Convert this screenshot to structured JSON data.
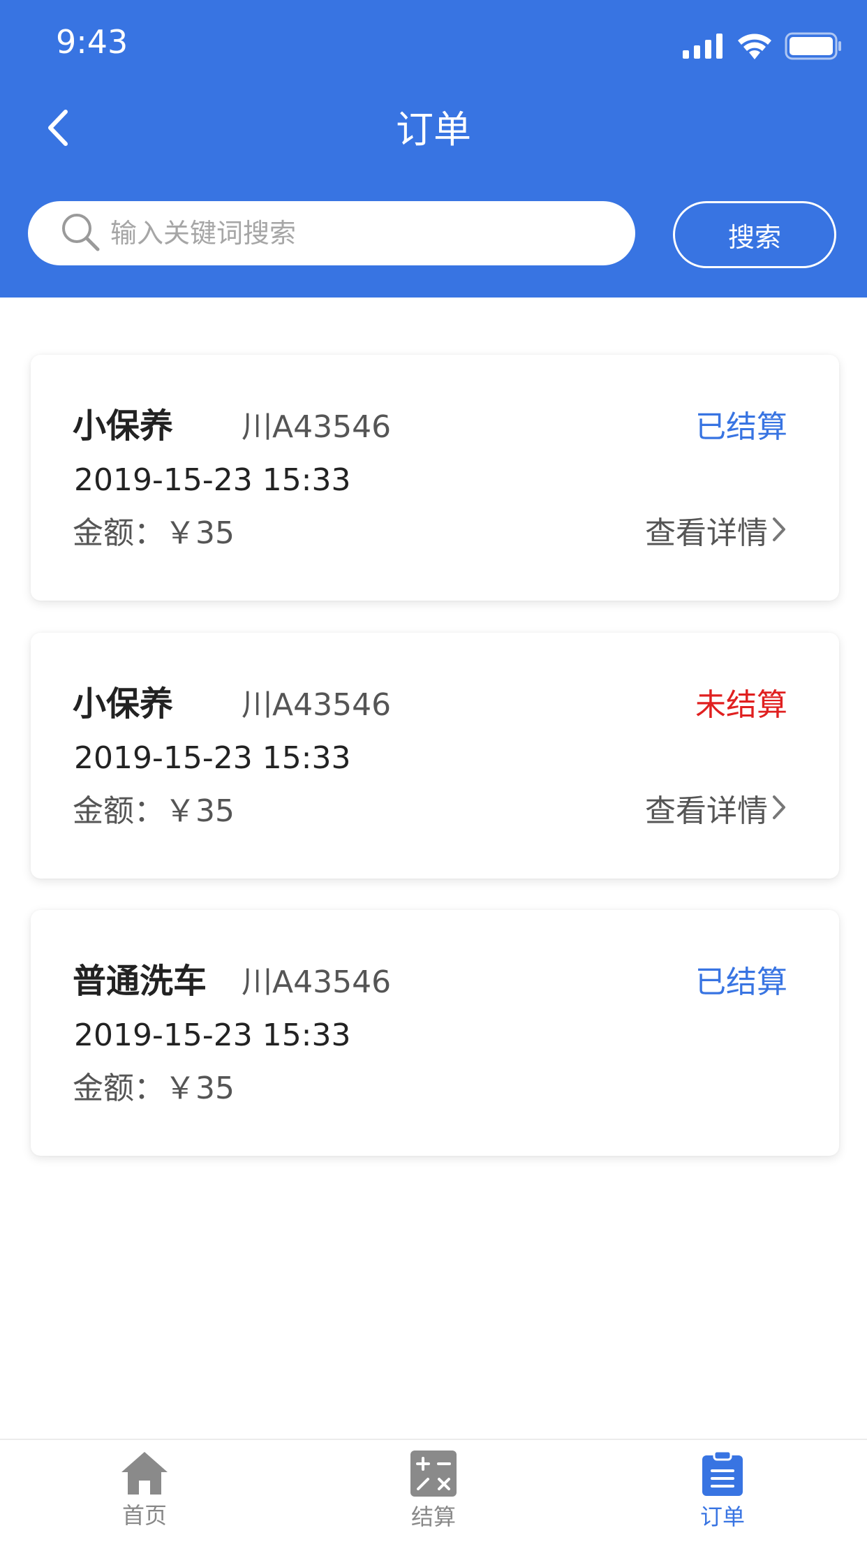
{
  "status_bar": {
    "time": "9:43",
    "icons": [
      "signal-icon",
      "wifi-icon",
      "battery-icon"
    ]
  },
  "nav": {
    "title": "订单",
    "back_icon": "chevron-left-icon"
  },
  "search": {
    "placeholder": "输入关键词搜索",
    "value": "",
    "button_label": "搜索"
  },
  "orders": [
    {
      "service": "小保养",
      "plate": "川A43546",
      "status": "已结算",
      "datetime": "2019-15-23 15:33",
      "amount_label": "金额：",
      "amount": "￥35",
      "detail_label": "查看详情"
    },
    {
      "service": "小保养",
      "plate": "川A43546",
      "status": "未结算",
      "datetime": "2019-15-23 15:33",
      "amount_label": "金额：",
      "amount": "￥35",
      "detail_label": "查看详情"
    },
    {
      "service": "普通洗车",
      "plate": "川A43546",
      "status": "已结算",
      "datetime": "2019-15-23 15:33",
      "amount_label": "金额：",
      "amount": "￥35"
    }
  ],
  "tabs": [
    {
      "label": "首页",
      "icon": "home-icon",
      "active": false
    },
    {
      "label": "结算",
      "icon": "calculator-icon",
      "active": false
    },
    {
      "label": "订单",
      "icon": "clipboard-icon",
      "active": true
    }
  ],
  "colors": {
    "primary": "#3874E2",
    "settled": "#3874E2",
    "unsettled": "#E02020",
    "tab_inactive": "#888888"
  }
}
